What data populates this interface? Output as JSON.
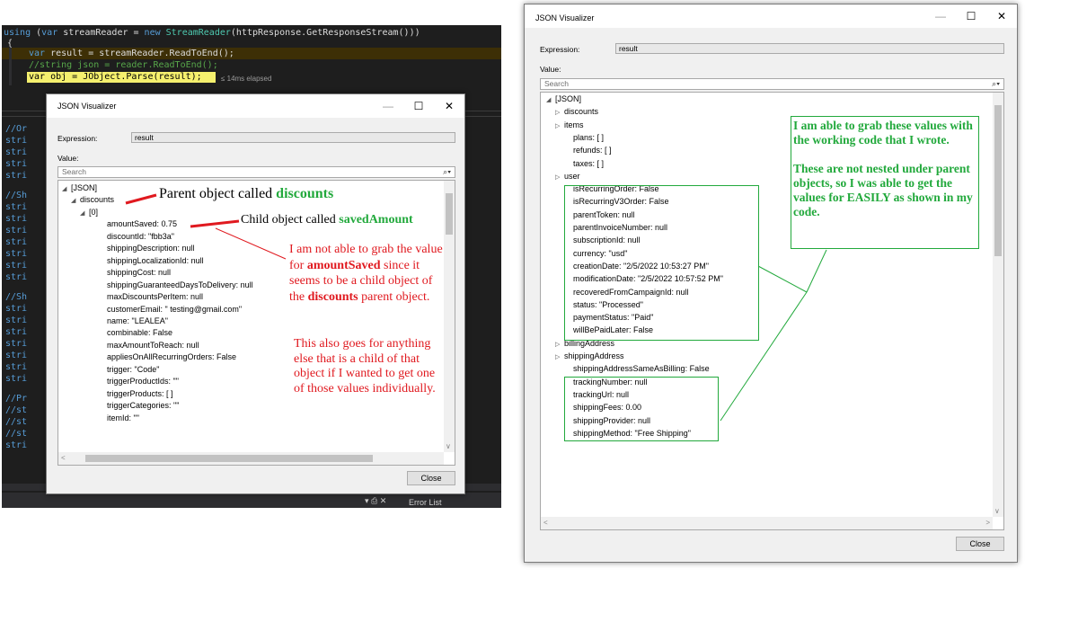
{
  "editor": {
    "line1": {
      "kw1": "using",
      "kw2": "var",
      "v1": " streamReader = ",
      "kw3": "new",
      "t1": "StreamReader",
      "rest": "(httpResponse.GetResponseStream()))"
    },
    "line2": "{",
    "line3": {
      "kw": "var",
      "rest": " result = streamReader.ReadToEnd();"
    },
    "line4": "//string json = reader.ReadToEnd();",
    "line5": {
      "code": "var obj = JObject.Parse(result);",
      "elapsed": "≤ 14ms elapsed"
    },
    "left_rows": [
      "//Or",
      "stri",
      "stri",
      "stri",
      "stri",
      "//Sh",
      "stri",
      "stri",
      "stri",
      "stri",
      "stri",
      "stri",
      "stri",
      "//Sh",
      "stri",
      "stri",
      "stri",
      "stri",
      "stri",
      "stri",
      "stri",
      "//Pr",
      "//st",
      "//st",
      "//st",
      "stri"
    ],
    "bottom_text": "Error List",
    "bottom_icons": "▾ ⎙ ✕"
  },
  "dialog1": {
    "title": "JSON Visualizer",
    "expression_label": "Expression:",
    "expression_value": "result",
    "value_label": "Value:",
    "search_placeholder": "Search",
    "close": "Close",
    "tree": [
      {
        "text": "[JSON]",
        "arrow": "◢",
        "indent": 0
      },
      {
        "text": "discounts",
        "arrow": "◢",
        "indent": 1
      },
      {
        "text": "[0]",
        "arrow": "◢",
        "indent": 2
      },
      {
        "text": "amountSaved: 0.75",
        "arrow": "",
        "indent": 4
      },
      {
        "text": "discountId: \"fbb3a\"",
        "arrow": "",
        "indent": 4
      },
      {
        "text": "shippingDescription: null",
        "arrow": "",
        "indent": 4
      },
      {
        "text": "shippingLocalizationId: null",
        "arrow": "",
        "indent": 4
      },
      {
        "text": "shippingCost: null",
        "arrow": "",
        "indent": 4
      },
      {
        "text": "shippingGuaranteedDaysToDelivery: null",
        "arrow": "",
        "indent": 4
      },
      {
        "text": "maxDiscountsPerItem: null",
        "arrow": "",
        "indent": 4
      },
      {
        "text": "customerEmail: \" testing@gmail.com\"",
        "arrow": "",
        "indent": 4
      },
      {
        "text": "name: \"LEALEA\"",
        "arrow": "",
        "indent": 4
      },
      {
        "text": "combinable: False",
        "arrow": "",
        "indent": 4
      },
      {
        "text": "maxAmountToReach: null",
        "arrow": "",
        "indent": 4
      },
      {
        "text": "appliesOnAllRecurringOrders: False",
        "arrow": "",
        "indent": 4
      },
      {
        "text": "trigger: \"Code\"",
        "arrow": "",
        "indent": 4
      },
      {
        "text": "triggerProductIds: \"\"",
        "arrow": "",
        "indent": 4
      },
      {
        "text": "triggerProducts: [ ]",
        "arrow": "",
        "indent": 4
      },
      {
        "text": "triggerCategories: \"\"",
        "arrow": "",
        "indent": 4
      },
      {
        "text": "itemId: \"\"",
        "arrow": "",
        "indent": 4
      }
    ]
  },
  "dialog2": {
    "title": "JSON Visualizer",
    "expression_label": "Expression:",
    "expression_value": "result",
    "value_label": "Value:",
    "search_placeholder": "Search",
    "close": "Close",
    "tree": [
      {
        "text": "[JSON]",
        "arrow": "◢",
        "indent": 0
      },
      {
        "text": "discounts",
        "arrow": "▷",
        "indent": 1
      },
      {
        "text": "items",
        "arrow": "▷",
        "indent": 1
      },
      {
        "text": "plans: [ ]",
        "arrow": "",
        "indent": 2
      },
      {
        "text": "refunds: [ ]",
        "arrow": "",
        "indent": 2
      },
      {
        "text": "taxes: [ ]",
        "arrow": "",
        "indent": 2
      },
      {
        "text": "user",
        "arrow": "▷",
        "indent": 1
      },
      {
        "text": "isRecurringOrder: False",
        "arrow": "",
        "indent": 2
      },
      {
        "text": "isRecurringV3Order: False",
        "arrow": "",
        "indent": 2
      },
      {
        "text": "parentToken: null",
        "arrow": "",
        "indent": 2
      },
      {
        "text": "parentInvoiceNumber: null",
        "arrow": "",
        "indent": 2
      },
      {
        "text": "subscriptionId: null",
        "arrow": "",
        "indent": 2
      },
      {
        "text": "currency: \"usd\"",
        "arrow": "",
        "indent": 2
      },
      {
        "text": "creationDate: \"2/5/2022 10:53:27 PM\"",
        "arrow": "",
        "indent": 2
      },
      {
        "text": "modificationDate: \"2/5/2022 10:57:52 PM\"",
        "arrow": "",
        "indent": 2
      },
      {
        "text": "recoveredFromCampaignId: null",
        "arrow": "",
        "indent": 2
      },
      {
        "text": "status: \"Processed\"",
        "arrow": "",
        "indent": 2
      },
      {
        "text": "paymentStatus: \"Paid\"",
        "arrow": "",
        "indent": 2
      },
      {
        "text": "willBePaidLater: False",
        "arrow": "",
        "indent": 2
      },
      {
        "text": "billingAddress",
        "arrow": "▷",
        "indent": 1
      },
      {
        "text": "shippingAddress",
        "arrow": "▷",
        "indent": 1
      },
      {
        "text": "shippingAddressSameAsBilling: False",
        "arrow": "",
        "indent": 2
      },
      {
        "text": "trackingNumber: null",
        "arrow": "",
        "indent": 2
      },
      {
        "text": "trackingUrl: null",
        "arrow": "",
        "indent": 2
      },
      {
        "text": "shippingFees: 0.00",
        "arrow": "",
        "indent": 2
      },
      {
        "text": "shippingProvider: null",
        "arrow": "",
        "indent": 2
      },
      {
        "text": "shippingMethod: \"Free Shipping\"",
        "arrow": "",
        "indent": 2
      }
    ]
  },
  "annotations": {
    "parent_prefix": "Parent object called ",
    "parent_name": "discounts",
    "child_prefix": "Child object called ",
    "child_name": "savedAmount",
    "red_p1_a": "I am not able to grab the value for ",
    "red_p1_bold1": "amountSaved",
    "red_p1_b": " since it seems to be a child object of the ",
    "red_p1_bold2": "discounts",
    "red_p1_c": " parent object.",
    "red_p2": "This also goes for anything else that is a child of that object if I wanted to get one of those values individually.",
    "green_p1": "I am able to grab these values with the working code that I wrote.",
    "green_p2": "These are not nested under parent objects, so I was able to get the values for EASILY as shown in my code."
  },
  "colors": {
    "red": "#e0191f",
    "green": "#22a93c",
    "editor_bg": "#1e1e1e"
  }
}
